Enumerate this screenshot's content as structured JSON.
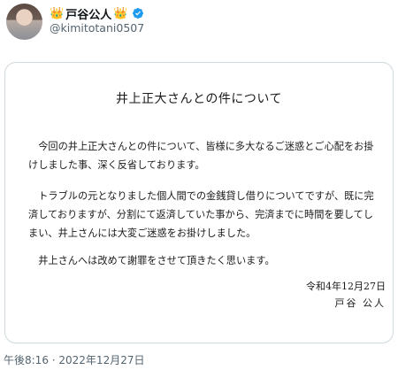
{
  "header": {
    "crown_left": "👑",
    "display_name": "戸谷公人",
    "crown_right": "👑",
    "handle": "@kimitotani0507",
    "verified_color": "#1d9bf0"
  },
  "statement": {
    "title": "井上正大さんとの件について",
    "paragraphs": [
      "　今回の井上正大さんとの件について、皆様に多大なるご迷惑とご心配をお掛けしました事、深く反省しております。",
      "　トラブルの元となりました個人間での金銭貸し借りについてですが、既に完済しておりますが、分割にて返済していた事から、完済までに時間を要してしまい、井上さんには大変ご迷惑をお掛けしました。",
      "　井上さんへは改めて謝罪をさせて頂きたく思います。"
    ],
    "date": "令和4年12月27日",
    "signature": "戸谷 公人"
  },
  "footer": {
    "timestamp": "午後8:16 · 2022年12月27日"
  }
}
